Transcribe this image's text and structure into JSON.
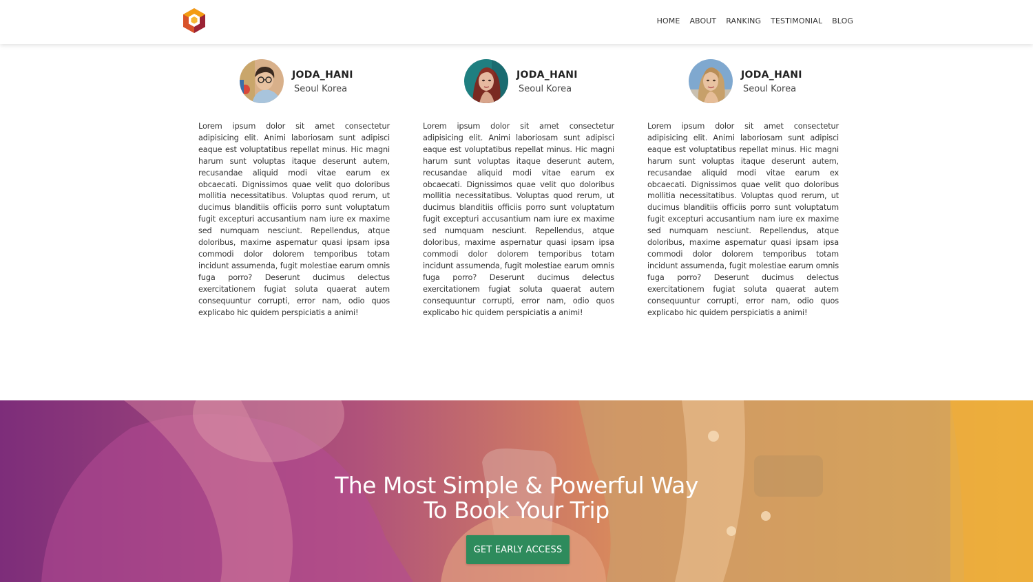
{
  "nav": {
    "items": [
      "HOME",
      "ABOUT",
      "RANKING",
      "TESTIMONIAL",
      "BLOG"
    ]
  },
  "testimonials": [
    {
      "name": "JODA_HANI",
      "location": "Seoul Korea",
      "text": "Lorem ipsum dolor sit amet consectetur adipisicing elit. Animi laboriosam sunt adipisci eaque est voluptatibus repellat minus. Hic magni harum sunt voluptas itaque deserunt autem, recusandae aliquid modi vitae earum ex obcaecati. Dignissimos quae velit quo doloribus mollitia necessitatibus. Voluptas quod rerum, ut ducimus blanditiis officiis porro sunt voluptatum fugit excepturi accusantium nam iure ex maxime sed numquam nesciunt. Repellendus, atque doloribus, maxime aspernatur quasi ipsam ipsa commodi dolor dolorem temporibus totam incidunt assumenda, fugit molestiae earum omnis fuga porro? Deserunt ducimus delectus exercitationem fugiat soluta quaerat autem consequuntur corrupti, error nam, odio quos explicabo hic quidem perspiciatis a animi!"
    },
    {
      "name": "JODA_HANI",
      "location": "Seoul Korea",
      "text": "Lorem ipsum dolor sit amet consectetur adipisicing elit. Animi laboriosam sunt adipisci eaque est voluptatibus repellat minus. Hic magni harum sunt voluptas itaque deserunt autem, recusandae aliquid modi vitae earum ex obcaecati. Dignissimos quae velit quo doloribus mollitia necessitatibus. Voluptas quod rerum, ut ducimus blanditiis officiis porro sunt voluptatum fugit excepturi accusantium nam iure ex maxime sed numquam nesciunt. Repellendus, atque doloribus, maxime aspernatur quasi ipsam ipsa commodi dolor dolorem temporibus totam incidunt assumenda, fugit molestiae earum omnis fuga porro? Deserunt ducimus delectus exercitationem fugiat soluta quaerat autem consequuntur corrupti, error nam, odio quos explicabo hic quidem perspiciatis a animi!"
    },
    {
      "name": "JODA_HANI",
      "location": "Seoul Korea",
      "text": "Lorem ipsum dolor sit amet consectetur adipisicing elit. Animi laboriosam sunt adipisci eaque est voluptatibus repellat minus. Hic magni harum sunt voluptas itaque deserunt autem, recusandae aliquid modi vitae earum ex obcaecati. Dignissimos quae velit quo doloribus mollitia necessitatibus. Voluptas quod rerum, ut ducimus blanditiis officiis porro sunt voluptatum fugit excepturi accusantium nam iure ex maxime sed numquam nesciunt. Repellendus, atque doloribus, maxime aspernatur quasi ipsam ipsa commodi dolor dolorem temporibus totam incidunt assumenda, fugit molestiae earum omnis fuga porro? Deserunt ducimus delectus exercitationem fugiat soluta quaerat autem consequuntur corrupti, error nam, odio quos explicabo hic quidem perspiciatis a animi!"
    }
  ],
  "hero": {
    "title_line1": "The Most Simple & Powerful Way",
    "title_line2": "To Book Your Trip",
    "cta_label": "GET EARLY ACCESS"
  },
  "colors": {
    "cta": "#2e8b5c",
    "gradient_left": "#7d2d7a",
    "gradient_right": "#e9a93a",
    "logo_orange": "#f39c12",
    "logo_red": "#c0392b"
  },
  "icons": {
    "logo": "hexagon-cube-logo-icon",
    "avatars": [
      "avatar-man-glasses",
      "avatar-woman-redhair",
      "avatar-woman-blonde"
    ]
  }
}
